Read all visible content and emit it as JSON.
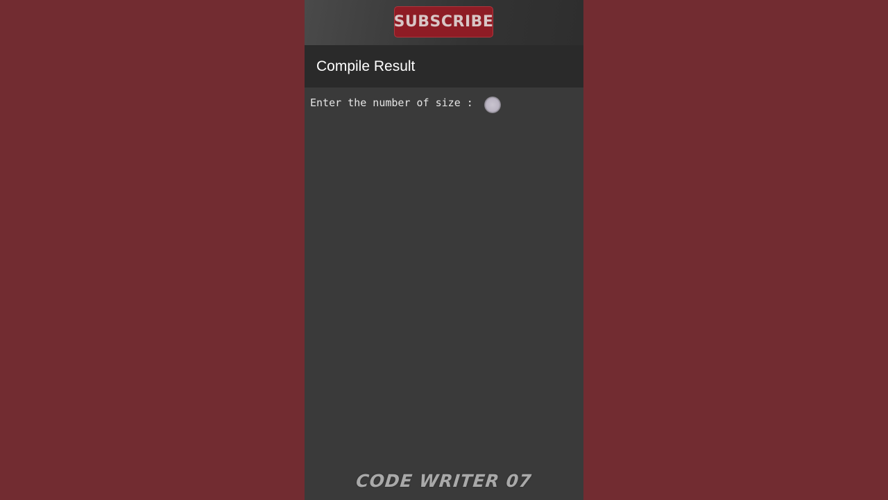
{
  "overlay": {
    "subscribe_label": "SUBSCRIBE",
    "subscribe_color": "#8e1c25"
  },
  "header": {
    "title": "Compile Result"
  },
  "console": {
    "prompt": "Enter the number of size : ",
    "input_value": ""
  },
  "watermark": {
    "text": "CODE WRITER 07"
  },
  "colors": {
    "background": "#722c31",
    "header_bg": "#2a2a2a",
    "console_bg": "#3a3a3a",
    "text": "#e6e6e6"
  }
}
